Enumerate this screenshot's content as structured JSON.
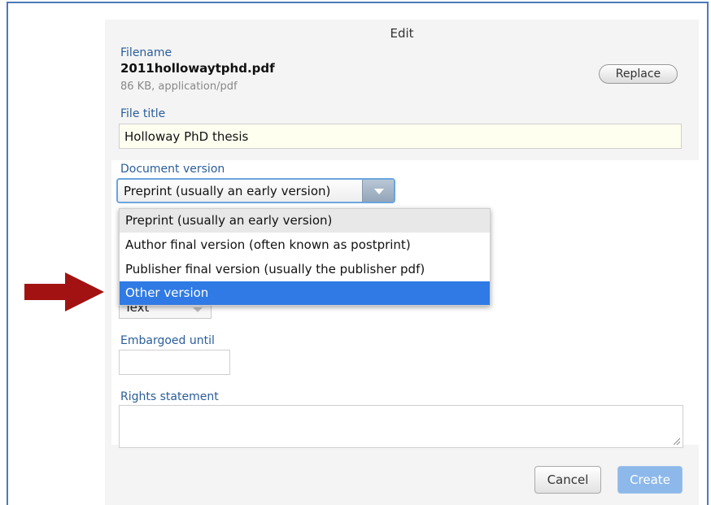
{
  "dialog": {
    "title": "Edit"
  },
  "file": {
    "label": "Filename",
    "name": "2011hollowaytphd.pdf",
    "meta": "86 KB, application/pdf",
    "replace_label": "Replace"
  },
  "file_title": {
    "label": "File title",
    "value": "Holloway PhD thesis"
  },
  "document_version": {
    "label": "Document version",
    "selected": "Preprint (usually an early version)",
    "options": [
      "Preprint (usually an early version)",
      "Author final version (often known as postprint)",
      "Publisher final version (usually the publisher pdf)",
      "Other version"
    ],
    "highlighted_option": "Other version"
  },
  "type": {
    "value": "Text"
  },
  "embargo": {
    "label": "Embargoed until",
    "value": ""
  },
  "rights": {
    "label": "Rights statement",
    "value": ""
  },
  "actions": {
    "cancel_label": "Cancel",
    "create_label": "Create"
  },
  "colors": {
    "label_blue": "#2a5d9a",
    "selected_blue": "#2f7ae5",
    "create_disabled": "#8db8ea",
    "annotation_arrow": "#a31212",
    "frame_border": "#4a7bb7"
  },
  "annotation": {
    "icon": "arrow-right-icon"
  }
}
